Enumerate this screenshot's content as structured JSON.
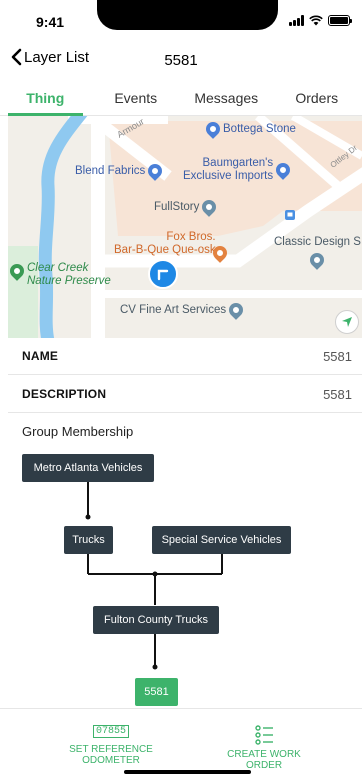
{
  "status_bar": {
    "time": "9:41"
  },
  "nav": {
    "back_label": "Layer List",
    "title": "5581"
  },
  "tabs": [
    {
      "label": "Thing",
      "active": true
    },
    {
      "label": "Events",
      "active": false
    },
    {
      "label": "Messages",
      "active": false
    },
    {
      "label": "Orders",
      "active": false
    }
  ],
  "map": {
    "streets": [
      "Armour",
      "Ottley Dr"
    ],
    "pois": [
      {
        "name": "Bottega Stone",
        "color": "#4a7fd8"
      },
      {
        "name": "Blend Fabrics",
        "color": "#4a7fd8"
      },
      {
        "name": "Baumgarten's Exclusive Imports",
        "line1": "Baumgarten's",
        "line2": "Exclusive Imports",
        "color": "#4a7fd8"
      },
      {
        "name": "FullStory",
        "color": "#6a8fa8"
      },
      {
        "name": "Fox Bros. Bar-B-Que Que-osk",
        "line1": "Fox Bros.",
        "line2": "Bar-B-Que Que-osk",
        "color": "#e3823f"
      },
      {
        "name": "Classic Design S",
        "color": "#6a8fa8"
      },
      {
        "name": "Clear Creek Nature Preserve",
        "line1": "Clear Creek",
        "line2": "Nature Preserve",
        "color": "#3a9a54"
      },
      {
        "name": "CV Fine Art Services",
        "color": "#6a8fa8"
      }
    ]
  },
  "details": [
    {
      "key": "NAME",
      "value": "5581"
    },
    {
      "key": "DESCRIPTION",
      "value": "5581"
    }
  ],
  "group": {
    "title": "Group Membership",
    "nodes": {
      "root": "Metro Atlanta Vehicles",
      "trucks": "Trucks",
      "special": "Special Service Vehicles",
      "fulton": "Fulton County Trucks",
      "leaf": "5581"
    }
  },
  "actions": {
    "odometer_reading": "07855",
    "set_reference_line1": "SET REFERENCE",
    "set_reference_line2": "ODOMETER",
    "create_work_line1": "CREATE WORK",
    "create_work_line2": "ORDER"
  },
  "colors": {
    "accent": "#3db36b",
    "node_bg": "#2f3c46",
    "location": "#1e88e5"
  }
}
